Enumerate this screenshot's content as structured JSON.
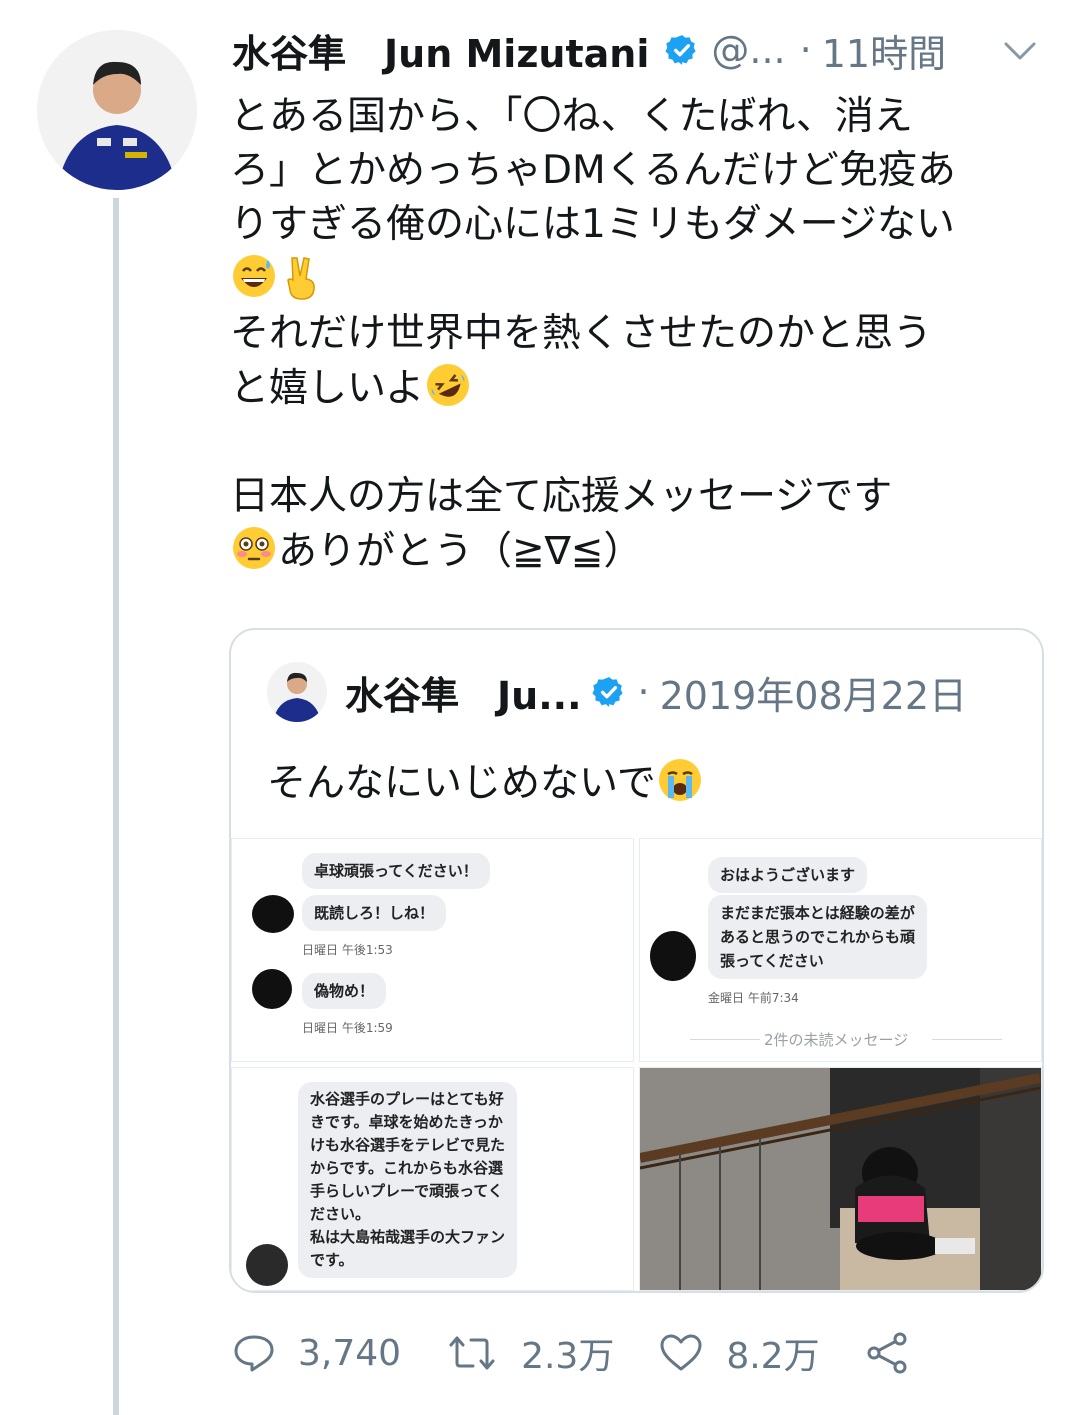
{
  "tweet": {
    "display_name": "水谷隼　Jun Mizutani",
    "handle": "@...",
    "dot": "·",
    "time": "11時間",
    "lines": [
      "とある国から、「〇ね、くたばれ、消え",
      "ろ」とかめっちゃDMくるんだけど免疫あ",
      "りすぎる俺の心には1ミリもダメージない",
      "",
      "それだけ世界中を熱くさせたのかと思う",
      "と嬉しいよ",
      "",
      "日本人の方は全て応援メッセージです",
      "ありがとう（≧∇≦）"
    ],
    "icons": [
      "chevron-down-icon",
      "verified-badge-icon",
      "grinning-sweat-emoji",
      "victory-hand-emoji",
      "rofl-emoji",
      "flushed-emoji"
    ]
  },
  "quote": {
    "display_name": "水谷隼　Ju...",
    "dot": "·",
    "date": "2019年08月22日",
    "text": "そんなにいじめないで",
    "icons": [
      "verified-badge-icon",
      "crying-emoji"
    ]
  },
  "dm1": {
    "b1": "卓球頑張ってください！",
    "b2": "既読しろ！しね！",
    "t1": "日曜日 午後1:53",
    "b3": "偽物め！",
    "t2": "日曜日 午後1:59"
  },
  "dm2": {
    "b1": "おはようございます",
    "b2": [
      "まだまだ張本とは経験の差が",
      "あると思うのでこれからも頑",
      "張ってください"
    ],
    "t1": "金曜日 午前7:34",
    "unread": "2件の未読メッセージ"
  },
  "dm3": {
    "lines": [
      "水谷選手のプレーはとても好",
      "きです。卓球を始めたきっか",
      "けも水谷選手をテレビで見た",
      "からです。これからも水谷選",
      "手らしいプレーで頑張ってく",
      "ださい。",
      "私は大島祐哉選手の大ファン",
      "です。"
    ]
  },
  "photo": {
    "label": "photo-crouching-in-stairwell"
  },
  "actions": {
    "replies": "3,740",
    "retweets": "2.3万",
    "likes": "8.2万",
    "icons": [
      "reply-icon",
      "retweet-icon",
      "like-icon",
      "share-icon"
    ]
  },
  "colors": {
    "verified": "#1da1f2",
    "secondary_text": "#657786",
    "border": "#d7dee5",
    "thread_line": "#ccd6dd"
  }
}
